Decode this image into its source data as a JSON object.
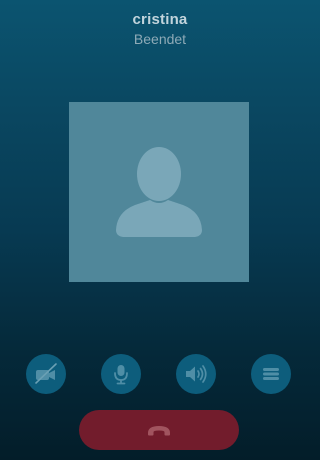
{
  "call": {
    "contact_name": "cristina",
    "status": "Beendet"
  },
  "controls": [
    {
      "name": "video",
      "icon": "video-off-icon",
      "enabled": false
    },
    {
      "name": "microphone",
      "icon": "microphone-icon"
    },
    {
      "name": "speaker",
      "icon": "speaker-icon"
    },
    {
      "name": "menu",
      "icon": "menu-icon"
    }
  ],
  "end_call": {
    "icon": "hang-up-icon",
    "color": "#721c2c"
  },
  "colors": {
    "background_top": "#0b5470",
    "background_bottom": "#031d29",
    "control_button": "#0d5d7c",
    "icon": "#4f8ea6",
    "avatar_bg": "#50879a",
    "avatar_silhouette": "#7aa7b8"
  }
}
